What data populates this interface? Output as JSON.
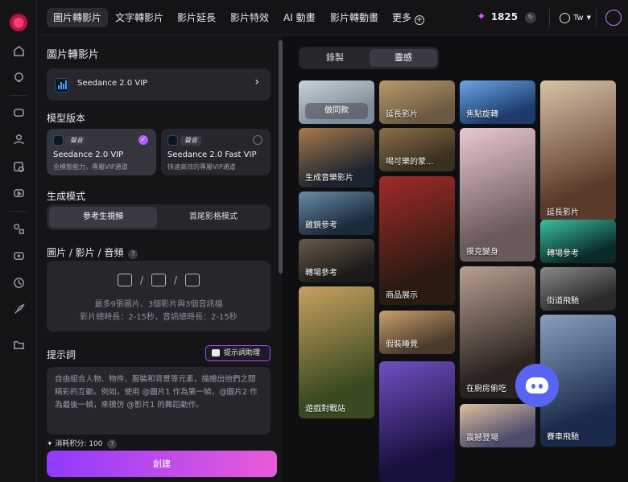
{
  "nav": {
    "tabs": [
      "圖片轉影片",
      "文字轉影片",
      "影片延長",
      "影片特效",
      "AI 動畫",
      "影片轉動畫",
      "更多"
    ],
    "credits": "1825",
    "language": "Tw"
  },
  "left": {
    "title": "圖片轉影片",
    "model_name": "Seedance 2.0 VIP",
    "version_heading": "模型版本",
    "versions": [
      {
        "tag": "聲音",
        "name": "Seedance 2.0 VIP",
        "desc": "全模態能力，專屬VIP通道",
        "selected": true
      },
      {
        "tag": "聲音",
        "name": "Seedance 2.0 Fast VIP",
        "desc": "快速高效的專屬VIP通道",
        "selected": false
      }
    ],
    "mode_heading": "生成模式",
    "modes": [
      "參考生視頻",
      "首尾影格模式"
    ],
    "media_heading": "圖片 / 影片 / 音頻",
    "help_mark": "?",
    "upload_sep": "/",
    "upload_line1": "最多9張圖片、3個影片與3個音訊檔",
    "upload_line2": "影片總時長：2-15秒，音訊總時長：2-15秒",
    "prompt_heading": "提示詞",
    "prompt_assist": "提示詞助理",
    "prompt_placeholder": "自由組合人物、物件、服裝和背景等元素，描繪出他們之間精彩的互動。例如，使用 @圖片1 作為第一幀，@圖片2 作為最後一幀，來模仿 @影片1 的舞蹈動作。",
    "cost_label": "消耗积分: 100",
    "create_label": "創建"
  },
  "right": {
    "tabs": [
      "錄製",
      "靈感"
    ],
    "tiles": [
      {
        "label": "做同款",
        "colors": [
          "#7d8a97",
          "#c9d2da"
        ]
      },
      {
        "label": "延長影片",
        "colors": [
          "#6b5a42",
          "#b89a6a"
        ]
      },
      {
        "label": "焦點旋轉",
        "colors": [
          "#1d3a6a",
          "#6aa6e8"
        ]
      },
      {
        "label": "延長影片",
        "colors": [
          "#5a3a2a",
          "#d9c2a8"
        ]
      },
      {
        "label": "生成音樂影片",
        "colors": [
          "#1c2430",
          "#a87a4a"
        ]
      },
      {
        "label": "喝可樂的蒙...",
        "colors": [
          "#3a3020",
          "#8a7048"
        ]
      },
      {
        "label": "摸克變身",
        "colors": [
          "#6a5a5a",
          "#e8c8d0"
        ]
      },
      {
        "label": "商品展示",
        "colors": [
          "#2a1a10",
          "#a02a2a"
        ]
      },
      {
        "label": "雞鏡參考",
        "colors": [
          "#1a2a3a",
          "#6a8aa8"
        ]
      },
      {
        "label": "轉場參考",
        "colors": [
          "#0a2a2a",
          "#3ac0a0"
        ]
      },
      {
        "label": "轉場參考",
        "colors": [
          "#1a1a1a",
          "#6a5a4a"
        ]
      },
      {
        "label": "街道飛馳",
        "colors": [
          "#2a2a2a",
          "#8a8a8a"
        ]
      },
      {
        "label": "在廚房偷吃",
        "colors": [
          "#2a2220",
          "#b8a090"
        ]
      },
      {
        "label": "遊戲對戰站",
        "colors": [
          "#3a4a20",
          "#c8a060"
        ]
      },
      {
        "label": "假裝睡覺",
        "colors": [
          "#4a3a2a",
          "#c8a070"
        ]
      },
      {
        "label": "賽車飛馳",
        "colors": [
          "#1a2a4a",
          "#8aa0c0"
        ]
      },
      {
        "label": "震撼登場",
        "colors": [
          "#4a4a6a",
          "#e0c0a0"
        ]
      },
      {
        "label": "",
        "colors": [
          "#1a1040",
          "#7050c0"
        ]
      }
    ]
  }
}
